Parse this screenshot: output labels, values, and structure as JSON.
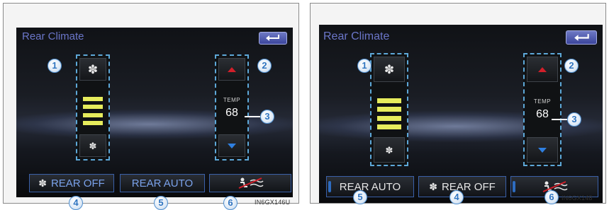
{
  "panels": [
    {
      "title": "Rear Climate",
      "temp_label": "TEMP",
      "temp_value": "68",
      "fan_level": 4,
      "buttons": [
        "REAR OFF",
        "REAR AUTO"
      ],
      "callouts": [
        "1",
        "2",
        "3"
      ],
      "bottom_numbers": [
        "4",
        "5",
        "6"
      ],
      "code": "IN6GX146U"
    },
    {
      "title": "Rear Climate",
      "temp_label": "TEMP",
      "temp_value": "68",
      "fan_level": 4,
      "buttons": [
        "REAR AUTO",
        "REAR OFF"
      ],
      "callouts": [
        "1",
        "2",
        "3"
      ],
      "bottom_numbers": [
        "5",
        "4",
        "6"
      ],
      "code": "IN6GX148"
    }
  ],
  "icons": {
    "back": "return-arrow-icon",
    "fan": "fan-icon",
    "up": "arrow-up-icon",
    "down": "arrow-down-icon",
    "airflow_off": "airflow-off-icon"
  },
  "colors": {
    "title": "#6b76c9",
    "level_bar": "#e6ec5c",
    "temp_up": "#d21f2a",
    "temp_down": "#2f7fe0",
    "highlight_border": "#5da8d8"
  }
}
